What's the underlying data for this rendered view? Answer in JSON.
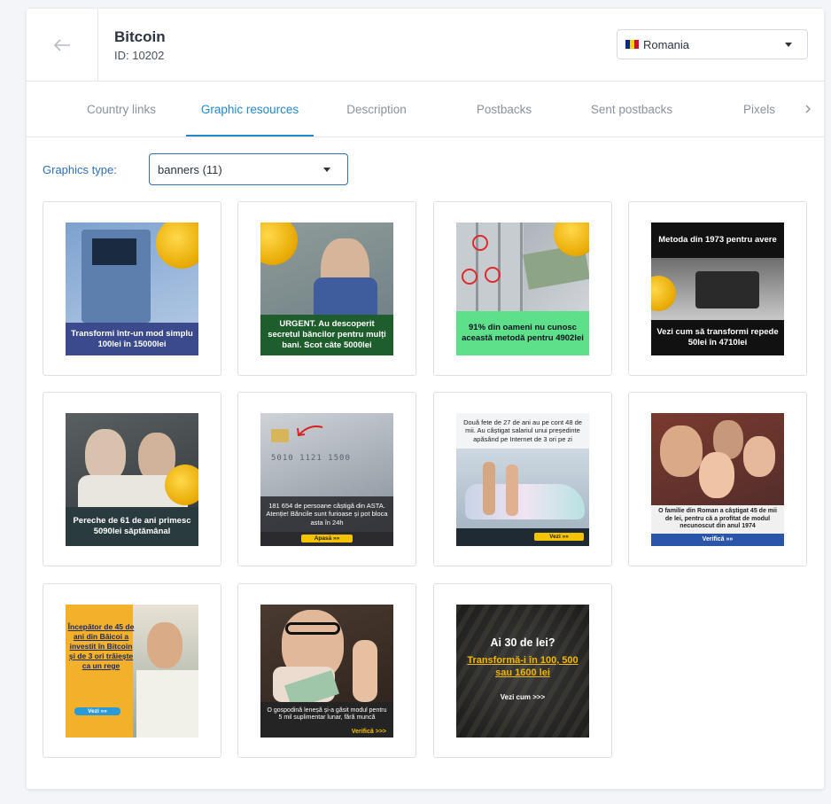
{
  "offer": {
    "name": "Bitcoin",
    "id_text": "ID: 10202"
  },
  "country": {
    "label": "Romania",
    "flag_colors": [
      "#002b7f",
      "#fcd116",
      "#ce1126"
    ]
  },
  "tabs": [
    {
      "label": "Country links",
      "active": false
    },
    {
      "label": "Graphic resources",
      "active": true
    },
    {
      "label": "Description",
      "active": false
    },
    {
      "label": "Postbacks",
      "active": false
    },
    {
      "label": "Sent postbacks",
      "active": false
    },
    {
      "label": "Pixels",
      "active": false
    }
  ],
  "graphics": {
    "label": "Graphics type:",
    "value": "banners (11)"
  },
  "banners": [
    {
      "text": "Transformi într-un mod simplu 100lei în 15000lei"
    },
    {
      "text": "URGENT. Au descoperit secretul băncilor pentru mulți bani. Scot câte 5000lei"
    },
    {
      "text": "91% din oameni nu cunosc această metodă pentru 4902lei"
    },
    {
      "top_text": "Metoda din 1973 pentru avere",
      "text": "Vezi cum să transformi repede 50lei în 4710lei"
    },
    {
      "text": "Pereche de 61 de ani primesc 5090lei săptămânal"
    },
    {
      "card_number": "5010 1121 1500",
      "text": "181 654 de persoane câștigă din ASTA. Atenție! Băncile sunt furioase și pot bloca asta în 24h",
      "button": "Apasă »»"
    },
    {
      "top_text": "Două fete de 27 de ani au pe cont 48 de mii. Au câștigat salariul unui președinte apăsând pe Internet de 3 ori pe zi",
      "button": "Vezi »»"
    },
    {
      "text": "O familie din Roman a câștigat 45 de mii de lei, pentru că a profitat de modul necunoscut din anul 1974",
      "button": "Verifică »»"
    },
    {
      "text": "Începător de 45 de ani din Băicoi a investit în Bitcoin și de 3 ori trăiește ca un rege",
      "button": "Vezi »»"
    },
    {
      "text": "O gospodină leneșă și-a găsit modul pentru 5 mil suplimentar lunar, fără muncă",
      "button": "Verifică >>>"
    },
    {
      "title": "Ai 30 de lei?",
      "highlight": "Transformă-i în 100, 500 sau 1600 lei",
      "button": "Vezi cum >>>"
    }
  ],
  "colors": {
    "accent": "#2389c9",
    "label_blue": "#2f6fb5",
    "border": "#dde1e6"
  }
}
